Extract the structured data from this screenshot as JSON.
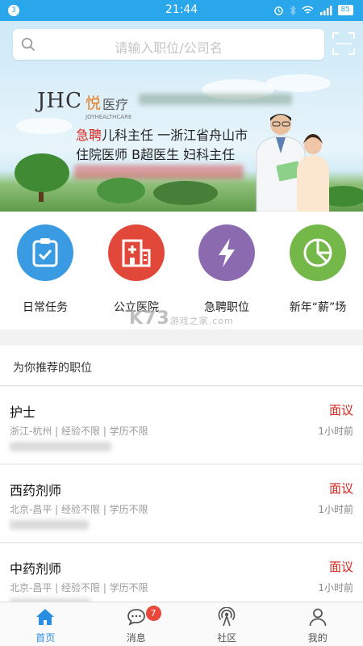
{
  "status_bar": {
    "notification_count": "3",
    "time": "21:44",
    "battery": "85"
  },
  "search": {
    "placeholder": "请输入职位/公司名"
  },
  "banner": {
    "brand": "JHC",
    "brand_cn": "悦",
    "brand_cn2": "医疗",
    "brand_en": "JOYHEALTHCARE",
    "urgent_word": "急聘",
    "headline_rest": "儿科主任 一浙江省舟山市",
    "line2": "住院医师    B超医生  妇科主任"
  },
  "quick_actions": [
    {
      "label": "日常任务",
      "icon": "clipboard-check-icon",
      "color": "#3a9be2"
    },
    {
      "label": "公立医院",
      "icon": "hospital-building-icon",
      "color": "#e2483a"
    },
    {
      "label": "急聘职位",
      "icon": "lightning-icon",
      "color": "#8c6ab0"
    },
    {
      "label": "新年“薪”场",
      "icon": "pie-chart-icon",
      "color": "#74b84a"
    }
  ],
  "watermark": {
    "main": "K73",
    "sub": "游戏之家",
    "domain": ".com"
  },
  "recommend": {
    "title": "为你推荐的职位"
  },
  "jobs": [
    {
      "title": "护士",
      "salary": "面议",
      "meta": "浙江-杭州 | 经验不限 | 学历不限",
      "time": "1小时前"
    },
    {
      "title": "西药剂师",
      "salary": "面议",
      "meta": "北京-昌平 | 经验不限 | 学历不限",
      "time": "1小时前"
    },
    {
      "title": "中药剂师",
      "salary": "面议",
      "meta": "北京-昌平 | 经验不限 | 学历不限",
      "time": "1小时前"
    }
  ],
  "tabbar": [
    {
      "label": "首页",
      "icon": "home-icon",
      "active": true
    },
    {
      "label": "消息",
      "icon": "chat-bubble-icon",
      "badge": "7"
    },
    {
      "label": "社区",
      "icon": "broadcast-icon"
    },
    {
      "label": "我的",
      "icon": "user-icon"
    }
  ]
}
